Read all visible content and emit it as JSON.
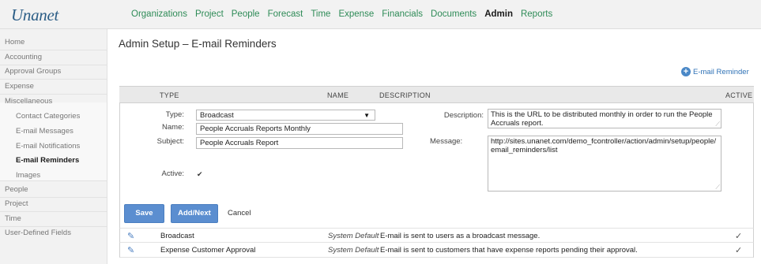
{
  "app": {
    "logo": "Unanet"
  },
  "topnav": [
    "Organizations",
    "Project",
    "People",
    "Forecast",
    "Time",
    "Expense",
    "Financials",
    "Documents",
    "Admin",
    "Reports"
  ],
  "topnav_active": "Admin",
  "sidebar": {
    "items": [
      "Home",
      "Accounting",
      "Approval Groups",
      "Expense",
      "Miscellaneous"
    ],
    "subitems": [
      "Contact Categories",
      "E-mail Messages",
      "E-mail Notifications",
      "E-mail Reminders",
      "Images"
    ],
    "active_subitem": "E-mail Reminders",
    "items_after": [
      "People",
      "Project",
      "Time",
      "User-Defined Fields"
    ]
  },
  "page": {
    "title": "Admin Setup – E-mail Reminders",
    "add_link": "E-mail Reminder"
  },
  "grid": {
    "headers": {
      "type": "TYPE",
      "name": "NAME",
      "description": "DESCRIPTION",
      "active": "ACTIVE"
    },
    "rows": [
      {
        "type": "Broadcast",
        "name": "System Default",
        "description": "E-mail is sent to users as a broadcast message.",
        "active": true
      },
      {
        "type": "Expense Customer Approval",
        "name": "System Default",
        "description": "E-mail is sent to customers that have expense reports pending their approval.",
        "active": true
      }
    ]
  },
  "form": {
    "type_label": "Type:",
    "type_value": "Broadcast",
    "name_label": "Name:",
    "name_value": "People Accruals Reports Monthly",
    "subject_label": "Subject:",
    "subject_value": "People Accruals Report",
    "active_label": "Active:",
    "active_checked": true,
    "description_label": "Description:",
    "description_value": "This is the URL to be distributed monthly in order to run the People Accruals report.",
    "message_label": "Message:",
    "message_value": "http://sites.unanet.com/demo_fcontroller/action/admin/setup/people/email_reminders/list"
  },
  "buttons": {
    "save": "Save",
    "add_next": "Add/Next",
    "cancel": "Cancel"
  },
  "colors": {
    "nav_link": "#2e8b57",
    "button": "#5b8ed0",
    "link": "#2f72b6"
  }
}
